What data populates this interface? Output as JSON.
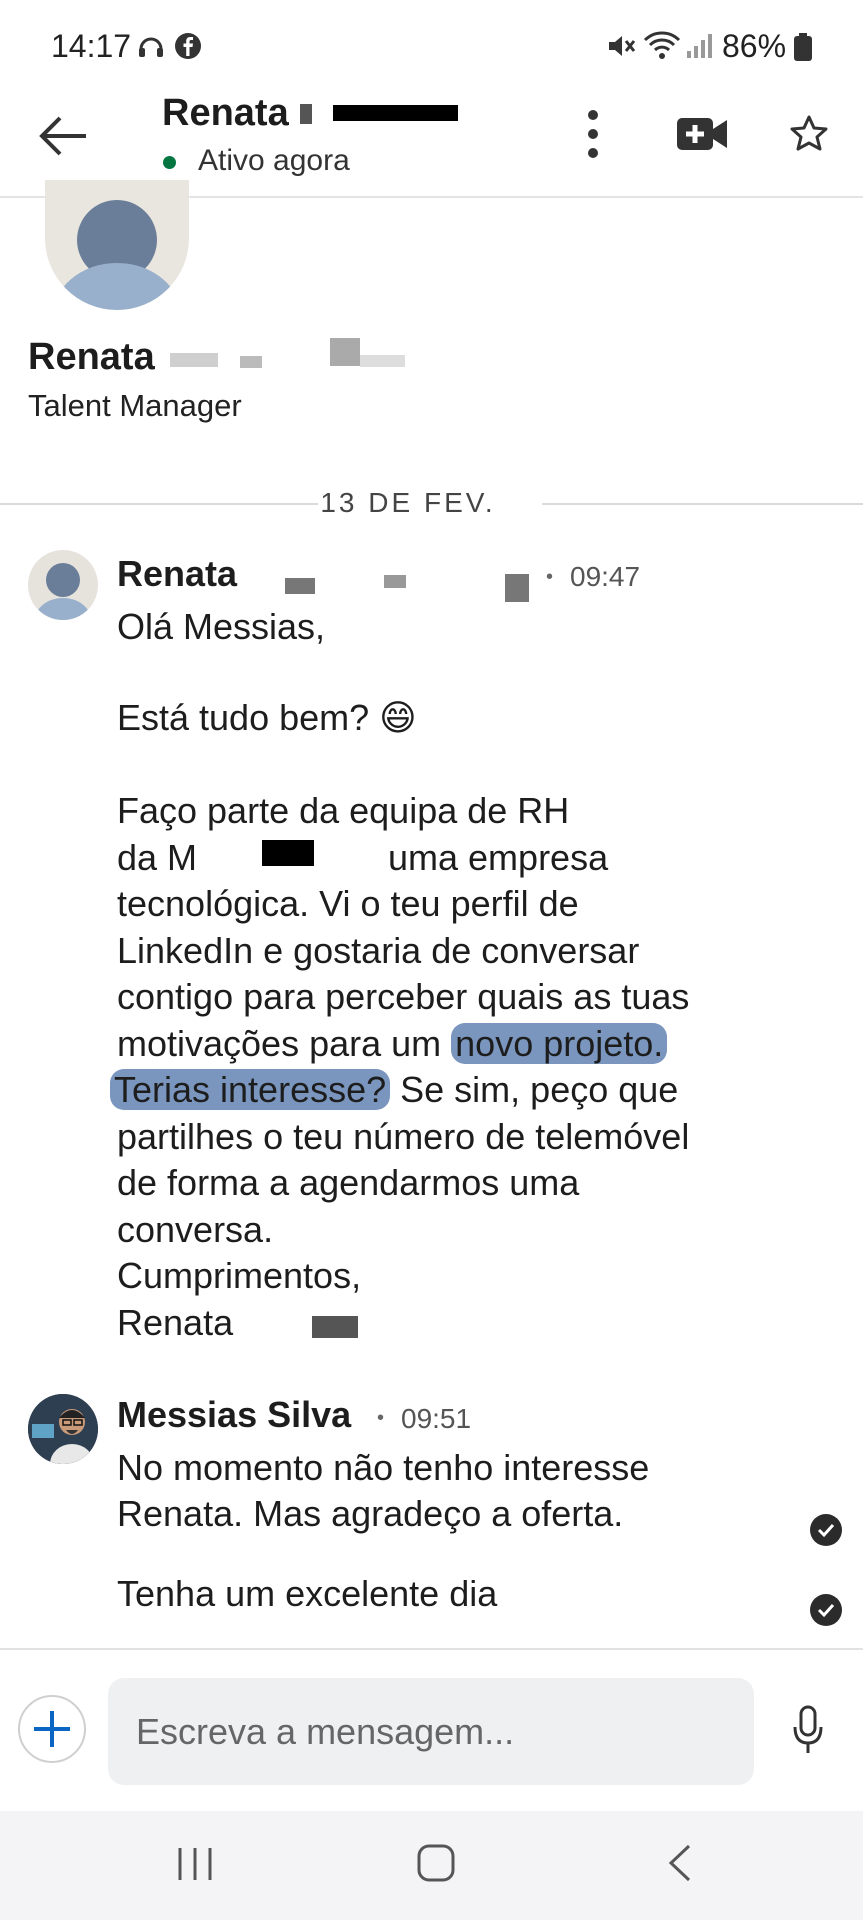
{
  "status_bar": {
    "time": "14:17",
    "battery": "86%",
    "icons": [
      "headset-icon",
      "facebook-icon",
      "mute-icon",
      "wifi-icon",
      "signal-icon",
      "battery-icon"
    ]
  },
  "header": {
    "name": "Renata",
    "status": "Ativo agora",
    "icons": [
      "back-arrow-icon",
      "more-vert-icon",
      "video-call-icon",
      "star-icon"
    ]
  },
  "profile": {
    "name": "Renata",
    "title": "Talent Manager"
  },
  "date_separator": "13 DE FEV.",
  "messages": [
    {
      "sender": "Renata",
      "time": "09:47",
      "lines": {
        "l1": "Olá Messias,",
        "l2": "Está tudo bem? 😄",
        "l3": "Faço parte da equipa de RH",
        "l4a": "da M",
        "l4b": "uma empresa",
        "l5": "tecnológica. Vi o teu perfil de",
        "l6": "LinkedIn e gostaria de conversar",
        "l7": "contigo para perceber quais as tuas",
        "l8a": "motivações para um ",
        "l8b": "novo projeto.",
        "l9a": "Terias interesse?",
        "l9b": " Se sim, peço que",
        "l10": "partilhes o teu número de telemóvel",
        "l11": "de forma a agendarmos uma",
        "l12": "conversa.",
        "l13": "Cumprimentos,",
        "l14": "Renata"
      }
    },
    {
      "sender": "Messias Silva",
      "time": "09:51",
      "lines": {
        "l1": "No momento não tenho interesse",
        "l2": "Renata. Mas agradeço a oferta.",
        "l3": "Tenha um excelente dia"
      }
    }
  ],
  "composer": {
    "placeholder": "Escreva a mensagem...",
    "icons": [
      "plus-icon",
      "microphone-icon"
    ]
  },
  "nav_bar": {
    "icons": [
      "recent-apps-icon",
      "home-icon",
      "back-icon"
    ]
  },
  "colors": {
    "online": "#057642",
    "highlight": "#7a96bf",
    "accent": "#0a66c2"
  }
}
